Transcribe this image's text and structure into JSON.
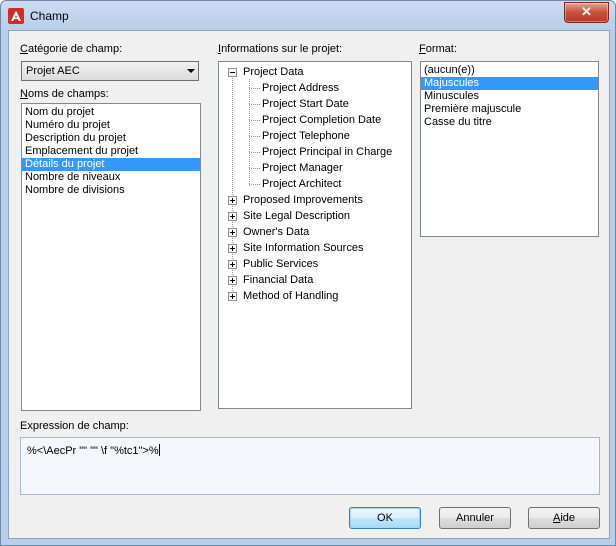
{
  "window": {
    "title": "Champ",
    "close_glyph": "✕",
    "app_icon": "autocad-logo-icon",
    "accent_color": "#d22b2b"
  },
  "category": {
    "label_first": "C",
    "label_rest": "atégorie de champ:",
    "selected": "Projet AEC"
  },
  "field_names": {
    "label_first": "N",
    "label_rest": "oms de champs:",
    "items": [
      {
        "label": "Nom du projet"
      },
      {
        "label": "Numéro du projet"
      },
      {
        "label": "Description du projet"
      },
      {
        "label": "Emplacement du projet"
      },
      {
        "label": "Détails du projet",
        "selected": true
      },
      {
        "label": "Nombre de niveaux"
      },
      {
        "label": "Nombre de divisions"
      }
    ]
  },
  "project_info": {
    "label_first": "I",
    "label_rest": "nformations sur le projet:",
    "root": {
      "label": "Project Data",
      "expanded": true
    },
    "children": [
      {
        "label": "Project Address"
      },
      {
        "label": "Project Start Date"
      },
      {
        "label": "Project Completion Date"
      },
      {
        "label": "Project Telephone"
      },
      {
        "label": "Project Principal in Charge"
      },
      {
        "label": "Project Manager"
      },
      {
        "label": "Project Architect"
      }
    ],
    "groups": [
      {
        "label": "Proposed Improvements"
      },
      {
        "label": "Site Legal Description"
      },
      {
        "label": "Owner's Data"
      },
      {
        "label": "Site Information Sources"
      },
      {
        "label": "Public Services"
      },
      {
        "label": "Financial Data"
      },
      {
        "label": "Method of Handling"
      }
    ]
  },
  "format": {
    "label_first": "F",
    "label_rest": "ormat:",
    "items": [
      {
        "label": "(aucun(e))"
      },
      {
        "label": "Majuscules",
        "selected": true
      },
      {
        "label": "Minuscules"
      },
      {
        "label": "Première majuscule"
      },
      {
        "label": "Casse du titre"
      }
    ]
  },
  "expression": {
    "label": "Expression de champ:",
    "value": "%<\\AecPr \"\" \"\" \\f \"%tc1\">%"
  },
  "buttons": {
    "ok": "OK",
    "cancel": "Annuler",
    "help_first": "A",
    "help_rest": "ide"
  }
}
